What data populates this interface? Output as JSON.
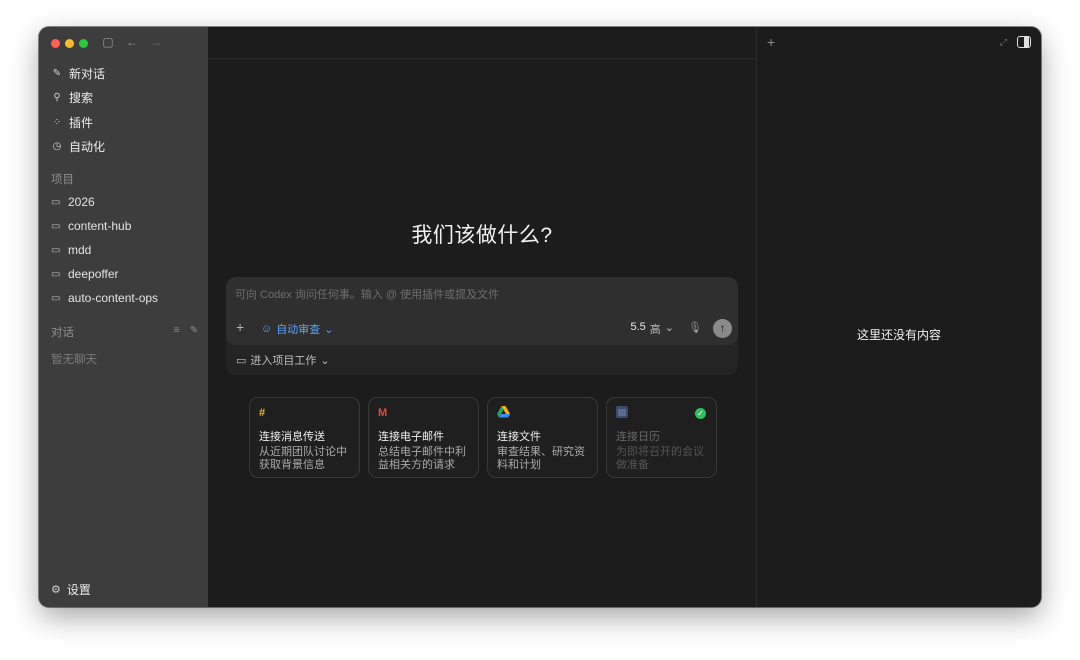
{
  "sidebar": {
    "nav": [
      {
        "label": "新对话",
        "icon": "edit-icon"
      },
      {
        "label": "搜索",
        "icon": "search-icon"
      },
      {
        "label": "插件",
        "icon": "plugins-icon"
      },
      {
        "label": "自动化",
        "icon": "clock-icon"
      }
    ],
    "projects_label": "项目",
    "projects": [
      "2026",
      "content-hub",
      "mdd",
      "deepoffer",
      "auto-content-ops"
    ],
    "conversations_label": "对话",
    "empty_chats": "暂无聊天",
    "settings_label": "设置"
  },
  "main": {
    "headline": "我们该做什么?",
    "composer": {
      "placeholder": "可向 Codex 询问任何事。输入 @ 使用插件或提及文件",
      "review_label": "自动审查",
      "model_version": "5.5",
      "model_level": "高",
      "project_work_label": "进入项目工作"
    },
    "cards": [
      {
        "title": "连接消息传送",
        "desc": "从近期团队讨论中获取背景信息",
        "icon": "slack-icon"
      },
      {
        "title": "连接电子邮件",
        "desc": "总结电子邮件中利益相关方的请求",
        "icon": "gmail-icon"
      },
      {
        "title": "连接文件",
        "desc": "审查结果、研究资料和计划",
        "icon": "drive-icon"
      },
      {
        "title": "连接日历",
        "desc": "为即将召开的会议做准备",
        "icon": "calendar-icon"
      }
    ]
  },
  "right_panel": {
    "empty_text": "这里还没有内容"
  },
  "colors": {
    "accent": "#5aa2ff",
    "sidebar_bg": "#3d3d3d",
    "main_bg": "#1c1c1c",
    "connected": "#2fbf62"
  }
}
